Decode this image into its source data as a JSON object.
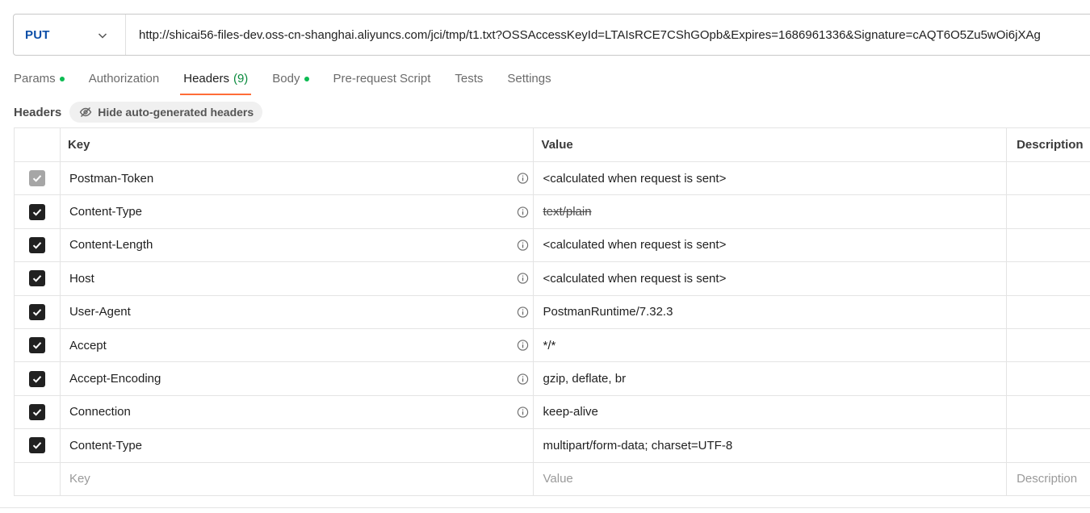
{
  "request": {
    "method": "PUT",
    "url": "http://shicai56-files-dev.oss-cn-shanghai.aliyuncs.com/jci/tmp/t1.txt?OSSAccessKeyId=LTAIsRCE7CShGOpb&Expires=1686961336&Signature=cAQT6O5Zu5wOi6jXAg"
  },
  "tabs": [
    {
      "label": "Params",
      "dot": true
    },
    {
      "label": "Authorization",
      "dot": false
    },
    {
      "label": "Headers",
      "count": "(9)",
      "active": true
    },
    {
      "label": "Body",
      "dot": true
    },
    {
      "label": "Pre-request Script"
    },
    {
      "label": "Tests"
    },
    {
      "label": "Settings"
    }
  ],
  "headers_section": {
    "title": "Headers",
    "hide_button": "Hide auto-generated headers"
  },
  "table": {
    "columns": {
      "key": "Key",
      "value": "Value",
      "description": "Description"
    },
    "rows": [
      {
        "key": "Postman-Token",
        "value": "<calculated when request is sent>"
      },
      {
        "key": "Content-Type",
        "value": "text/plain"
      },
      {
        "key": "Content-Length",
        "value": "<calculated when request is sent>"
      },
      {
        "key": "Host",
        "value": "<calculated when request is sent>"
      },
      {
        "key": "User-Agent",
        "value": "PostmanRuntime/7.32.3"
      },
      {
        "key": "Accept",
        "value": "*/*"
      },
      {
        "key": "Accept-Encoding",
        "value": "gzip, deflate, br"
      },
      {
        "key": "Connection",
        "value": "keep-alive"
      },
      {
        "key": "Content-Type",
        "value": "multipart/form-data; charset=UTF-8"
      }
    ],
    "placeholders": {
      "key": "Key",
      "value": "Value",
      "description": "Description"
    }
  },
  "colors": {
    "method": "#0c4fa8",
    "active_tab_underline": "#ff6c37",
    "dot": "#0cbb52",
    "count": "#0b8b3e"
  }
}
